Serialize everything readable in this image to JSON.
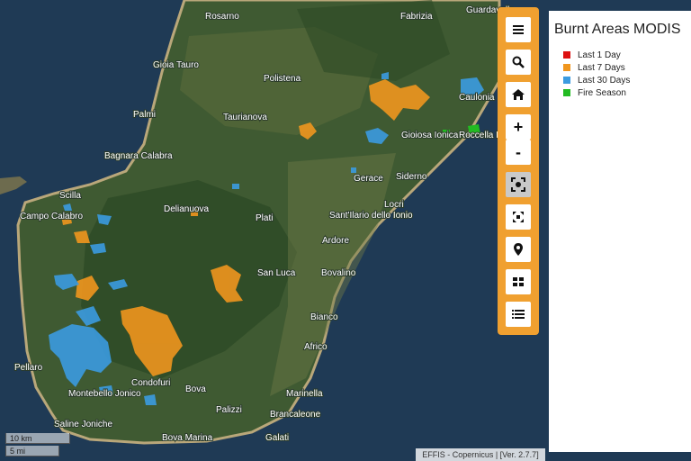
{
  "map": {
    "water_color": "#1f3a55",
    "land_color": "#3f5a32",
    "mountain_color": "#2d4a25",
    "coast_color": "#b9a77a",
    "places": [
      {
        "name": "Guardavalle"
      },
      {
        "name": "Rosarno"
      },
      {
        "name": "Fabrizia"
      },
      {
        "name": "Gioia Tauro"
      },
      {
        "name": "Polistena"
      },
      {
        "name": "Caulonia"
      },
      {
        "name": "Palmi"
      },
      {
        "name": "Taurianova"
      },
      {
        "name": "Gioiosa Ionica"
      },
      {
        "name": "Roccella Ionica"
      },
      {
        "name": "Bagnara Calabra"
      },
      {
        "name": "Gerace"
      },
      {
        "name": "Siderno"
      },
      {
        "name": "Scilla"
      },
      {
        "name": "Delianuova"
      },
      {
        "name": "Locri"
      },
      {
        "name": "Campo Calabro"
      },
      {
        "name": "Plati"
      },
      {
        "name": "Sant'Ilario dello Ionio"
      },
      {
        "name": "Ardore"
      },
      {
        "name": "San Luca"
      },
      {
        "name": "Bovalino"
      },
      {
        "name": "Bianco"
      },
      {
        "name": "Africo"
      },
      {
        "name": "Pellaro"
      },
      {
        "name": "Condofuri"
      },
      {
        "name": "Montebello Jonico"
      },
      {
        "name": "Bova"
      },
      {
        "name": "Marinella"
      },
      {
        "name": "Palizzi"
      },
      {
        "name": "Brancaleone"
      },
      {
        "name": "Saline Joniche"
      },
      {
        "name": "Bova Marina"
      },
      {
        "name": "Galati"
      }
    ]
  },
  "toolbar": {
    "buttons": [
      {
        "id": "menu",
        "icon": "menu-icon"
      },
      {
        "id": "search",
        "icon": "search-icon"
      },
      {
        "id": "home",
        "icon": "home-icon"
      },
      {
        "id": "zoom-in",
        "icon": "plus-icon",
        "label": "+"
      },
      {
        "id": "zoom-out",
        "icon": "minus-icon",
        "label": "-"
      },
      {
        "id": "focus",
        "icon": "focus-icon"
      },
      {
        "id": "fullscreen",
        "icon": "fullscreen-icon"
      },
      {
        "id": "location",
        "icon": "location-pin-icon"
      },
      {
        "id": "layers",
        "icon": "grid-icon"
      },
      {
        "id": "list",
        "icon": "list-icon"
      }
    ]
  },
  "legend": {
    "title": "Burnt Areas MODIS",
    "items": [
      {
        "label": "Last 1 Day",
        "color": "#dd1111"
      },
      {
        "label": "Last 7 Days",
        "color": "#f0961e"
      },
      {
        "label": "Last 30 Days",
        "color": "#3b9be0"
      },
      {
        "label": "Fire Season",
        "color": "#22bb22"
      }
    ]
  },
  "scale": {
    "km": "10 km",
    "mi": "5 mi"
  },
  "attribution": "EFFIS - Copernicus | [Ver. 2.7.7]"
}
